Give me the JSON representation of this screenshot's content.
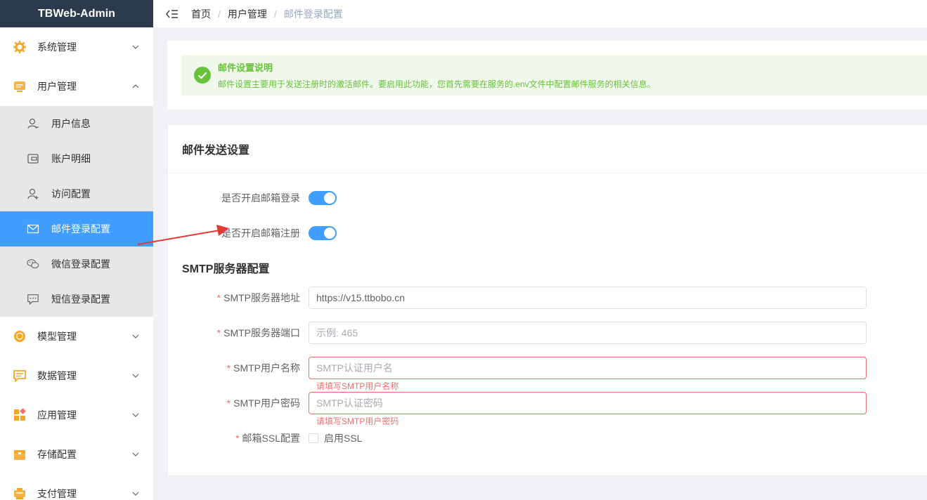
{
  "brand": "TBWeb-Admin",
  "sidebar": {
    "top_items": [
      {
        "label": "系统管理",
        "icon": "gear-icon"
      },
      {
        "label": "用户管理",
        "icon": "user-management-icon"
      }
    ],
    "sub_items": [
      {
        "label": "用户信息",
        "icon": "user-info-icon"
      },
      {
        "label": "账户明细",
        "icon": "wallet-icon"
      },
      {
        "label": "访问配置",
        "icon": "user-add-icon"
      },
      {
        "label": "邮件登录配置",
        "icon": "mail-icon"
      },
      {
        "label": "微信登录配置",
        "icon": "wechat-icon"
      },
      {
        "label": "短信登录配置",
        "icon": "chat-dots-icon"
      }
    ],
    "bottom_items": [
      {
        "label": "模型管理",
        "icon": "cube-icon"
      },
      {
        "label": "数据管理",
        "icon": "message-box-icon"
      },
      {
        "label": "应用管理",
        "icon": "apps-icon"
      },
      {
        "label": "存储配置",
        "icon": "box-icon"
      },
      {
        "label": "支付管理",
        "icon": "payment-icon"
      }
    ]
  },
  "breadcrumb": [
    "首页",
    "用户管理",
    "邮件登录配置"
  ],
  "alert": {
    "title": "邮件设置说明",
    "description": "邮件设置主要用于发送注册时的激活邮件。要启用此功能，您首先需要在服务的.env文件中配置邮件服务的相关信息。"
  },
  "mail_card": {
    "title": "邮件发送设置",
    "switch_login_label": "是否开启邮箱登录",
    "switch_login_on": true,
    "switch_register_label": "是否开启邮箱注册",
    "switch_register_on": true,
    "smtp_section_title": "SMTP服务器配置",
    "smtp_host_label": "SMTP服务器地址",
    "smtp_host_value": "https://v15.ttbobo.cn",
    "smtp_port_label": "SMTP服务器端口",
    "smtp_port_placeholder": "示例: 465",
    "smtp_user_label": "SMTP用户名称",
    "smtp_user_placeholder": "SMTP认证用户名",
    "smtp_user_error": "请填写SMTP用户名称",
    "smtp_pass_label": "SMTP用户密码",
    "smtp_pass_placeholder": "SMTP认证密码",
    "smtp_pass_error": "请填写SMTP用户密码",
    "ssl_label": "邮箱SSL配置",
    "ssl_checkbox_label": "启用SSL",
    "ssl_checked": false
  },
  "colors": {
    "primary": "#409eff",
    "success": "#67c23a",
    "danger": "#f56c6c",
    "sidebar_header": "#2b3a4d",
    "annotation_arrow": "#e53935"
  }
}
